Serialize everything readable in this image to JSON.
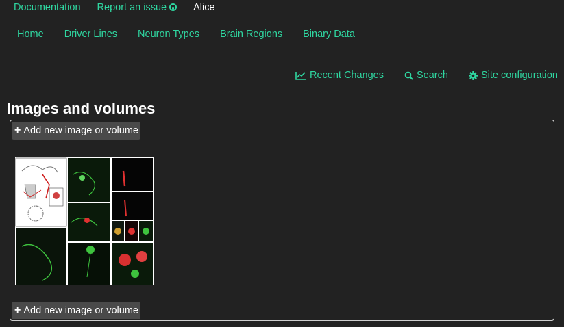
{
  "topbar": {
    "documentation": "Documentation",
    "report_issue": "Report an issue",
    "user": "Alice"
  },
  "mainnav": [
    "Home",
    "Driver Lines",
    "Neuron Types",
    "Brain Regions",
    "Binary Data"
  ],
  "subnav": {
    "recent_changes": "Recent Changes",
    "search": "Search",
    "site_config": "Site configuration"
  },
  "page": {
    "title": "Images and volumes",
    "add_button_label": "Add new image or volume"
  },
  "icons": {
    "report_issue": "github-icon",
    "recent_changes": "line-chart-icon",
    "search": "search-icon",
    "site_config": "gear-icon",
    "add": "plus-icon"
  },
  "colors": {
    "background": "#222222",
    "link": "#2fd6a0",
    "button_bg": "#4a4a4a"
  }
}
